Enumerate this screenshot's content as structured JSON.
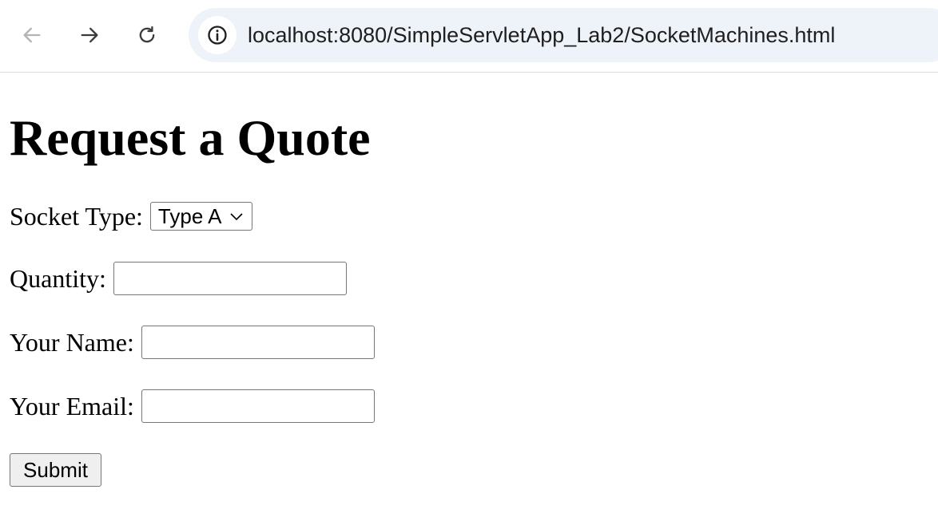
{
  "browser": {
    "url": "localhost:8080/SimpleServletApp_Lab2/SocketMachines.html",
    "icons": {
      "back": "arrow-left-icon",
      "forward": "arrow-right-icon",
      "reload": "reload-icon",
      "site_info": "info-icon"
    }
  },
  "page": {
    "title": "Request a Quote",
    "form": {
      "socket_type": {
        "label": "Socket Type:",
        "selected": "Type A"
      },
      "quantity": {
        "label": "Quantity:",
        "value": ""
      },
      "name": {
        "label": "Your Name:",
        "value": ""
      },
      "email": {
        "label": "Your Email:",
        "value": ""
      },
      "submit_label": "Submit"
    }
  },
  "colors": {
    "omnibox_bg": "#eef2f9",
    "control_border": "#767676",
    "button_bg": "#efefef"
  }
}
